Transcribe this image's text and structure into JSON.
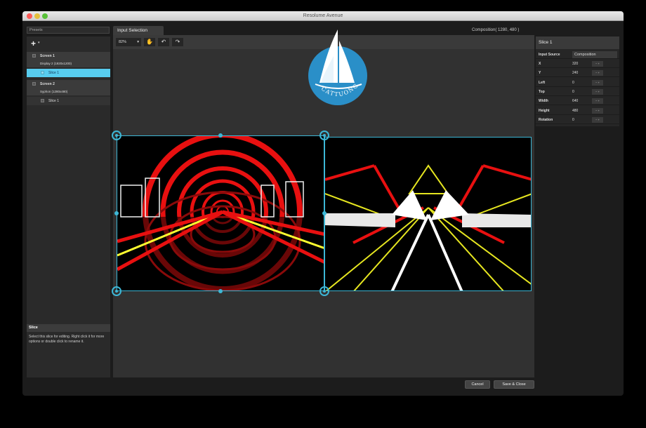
{
  "window": {
    "title": "Resolume Avenue"
  },
  "presets": {
    "value": "Presets"
  },
  "tree": {
    "screens": [
      {
        "label": "Screen 1",
        "output": "Display 2 (1920x1200)",
        "slices": [
          {
            "label": "Slice 1",
            "selected": true
          }
        ]
      },
      {
        "label": "Screen 2",
        "output": "Syphon (1280x480)",
        "slices": [
          {
            "label": "Slice 1",
            "selected": false
          }
        ]
      }
    ]
  },
  "info": {
    "title": "Slice",
    "text": "Select this slice for editing. Right click it for more options or double click to rename it."
  },
  "tabs": {
    "input_selection": "Input Selection"
  },
  "composition": {
    "label": "Composition( 1280, 480 )"
  },
  "toolbar": {
    "zoom": "82%",
    "hand_icon": "hand-icon",
    "undo_icon": "undo-icon",
    "redo_icon": "redo-icon"
  },
  "properties": {
    "title": "Slice 1",
    "input_source_label": "Input Source",
    "input_source_value": "Composition",
    "rows": [
      {
        "label": "X",
        "value": "320"
      },
      {
        "label": "Y",
        "value": "240"
      },
      {
        "label": "Left",
        "value": "0"
      },
      {
        "label": "Top",
        "value": "0"
      },
      {
        "label": "Width",
        "value": "640"
      },
      {
        "label": "Height",
        "value": "480"
      },
      {
        "label": "Rotation",
        "value": "0"
      }
    ]
  },
  "buttons": {
    "cancel": "Cancel",
    "save_close": "Save & Close"
  },
  "watermark": {
    "text": "CATTUONG"
  },
  "colors": {
    "accent": "#3db7d6",
    "selected": "#58ccee"
  }
}
